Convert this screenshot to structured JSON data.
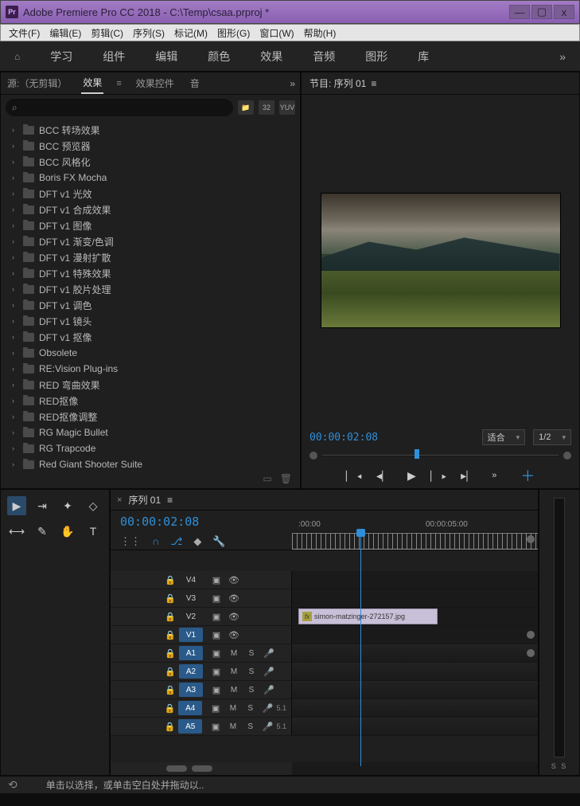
{
  "app": {
    "title": "Adobe Premiere Pro CC 2018 - C:\\Temp\\csaa.prproj *",
    "logo": "Pr"
  },
  "winbtns": {
    "min": "—",
    "max": "▢",
    "close": "x"
  },
  "menubar": [
    "文件(F)",
    "编辑(E)",
    "剪辑(C)",
    "序列(S)",
    "标记(M)",
    "图形(G)",
    "窗口(W)",
    "帮助(H)"
  ],
  "workspaces": [
    "学习",
    "组件",
    "编辑",
    "颜色",
    "效果",
    "音频",
    "图形",
    "库"
  ],
  "source_tabs": {
    "t1": "源:（无剪辑）",
    "t2": "效果",
    "t3": "效果控件",
    "t4": "音"
  },
  "search": {
    "placeholder": ""
  },
  "search_icons": [
    "📁",
    "32",
    "YUV"
  ],
  "effects": [
    "BCC 转场效果",
    "BCC 预览器",
    "BCC 风格化",
    "Boris FX Mocha",
    "DFT v1 光效",
    "DFT v1 合成效果",
    "DFT v1 图像",
    "DFT v1 渐变/色调",
    "DFT v1 漫射扩散",
    "DFT v1 特殊效果",
    "DFT v1 胶片处理",
    "DFT v1 调色",
    "DFT v1 镜头",
    "DFT v1 抠像",
    "Obsolete",
    "RE:Vision Plug-ins",
    "RED 弯曲效果",
    "RED抠像",
    "RED抠像调整",
    "RG Magic Bullet",
    "RG Trapcode",
    "Red Giant Shooter Suite"
  ],
  "program": {
    "title": "节目: 序列 01"
  },
  "program_tc": "00:00:02:08",
  "fit": {
    "label": "适合"
  },
  "res": {
    "label": "1/2"
  },
  "timeline": {
    "title": "序列 01",
    "tc": "00:00:02:08",
    "ruler": [
      ":00:00",
      "00:00:05:00"
    ],
    "tracks_v": [
      "V4",
      "V3",
      "V2",
      "V1"
    ],
    "track_v_active": "V1",
    "tracks_a": [
      "A1",
      "A2",
      "A3",
      "A4",
      "A5"
    ],
    "clip_name": "simon-matzinger-272157.jpg",
    "surround": "5.1"
  },
  "status": "单击以选择，或单击空白处并拖动以..",
  "meter": {
    "ss": "S S"
  }
}
